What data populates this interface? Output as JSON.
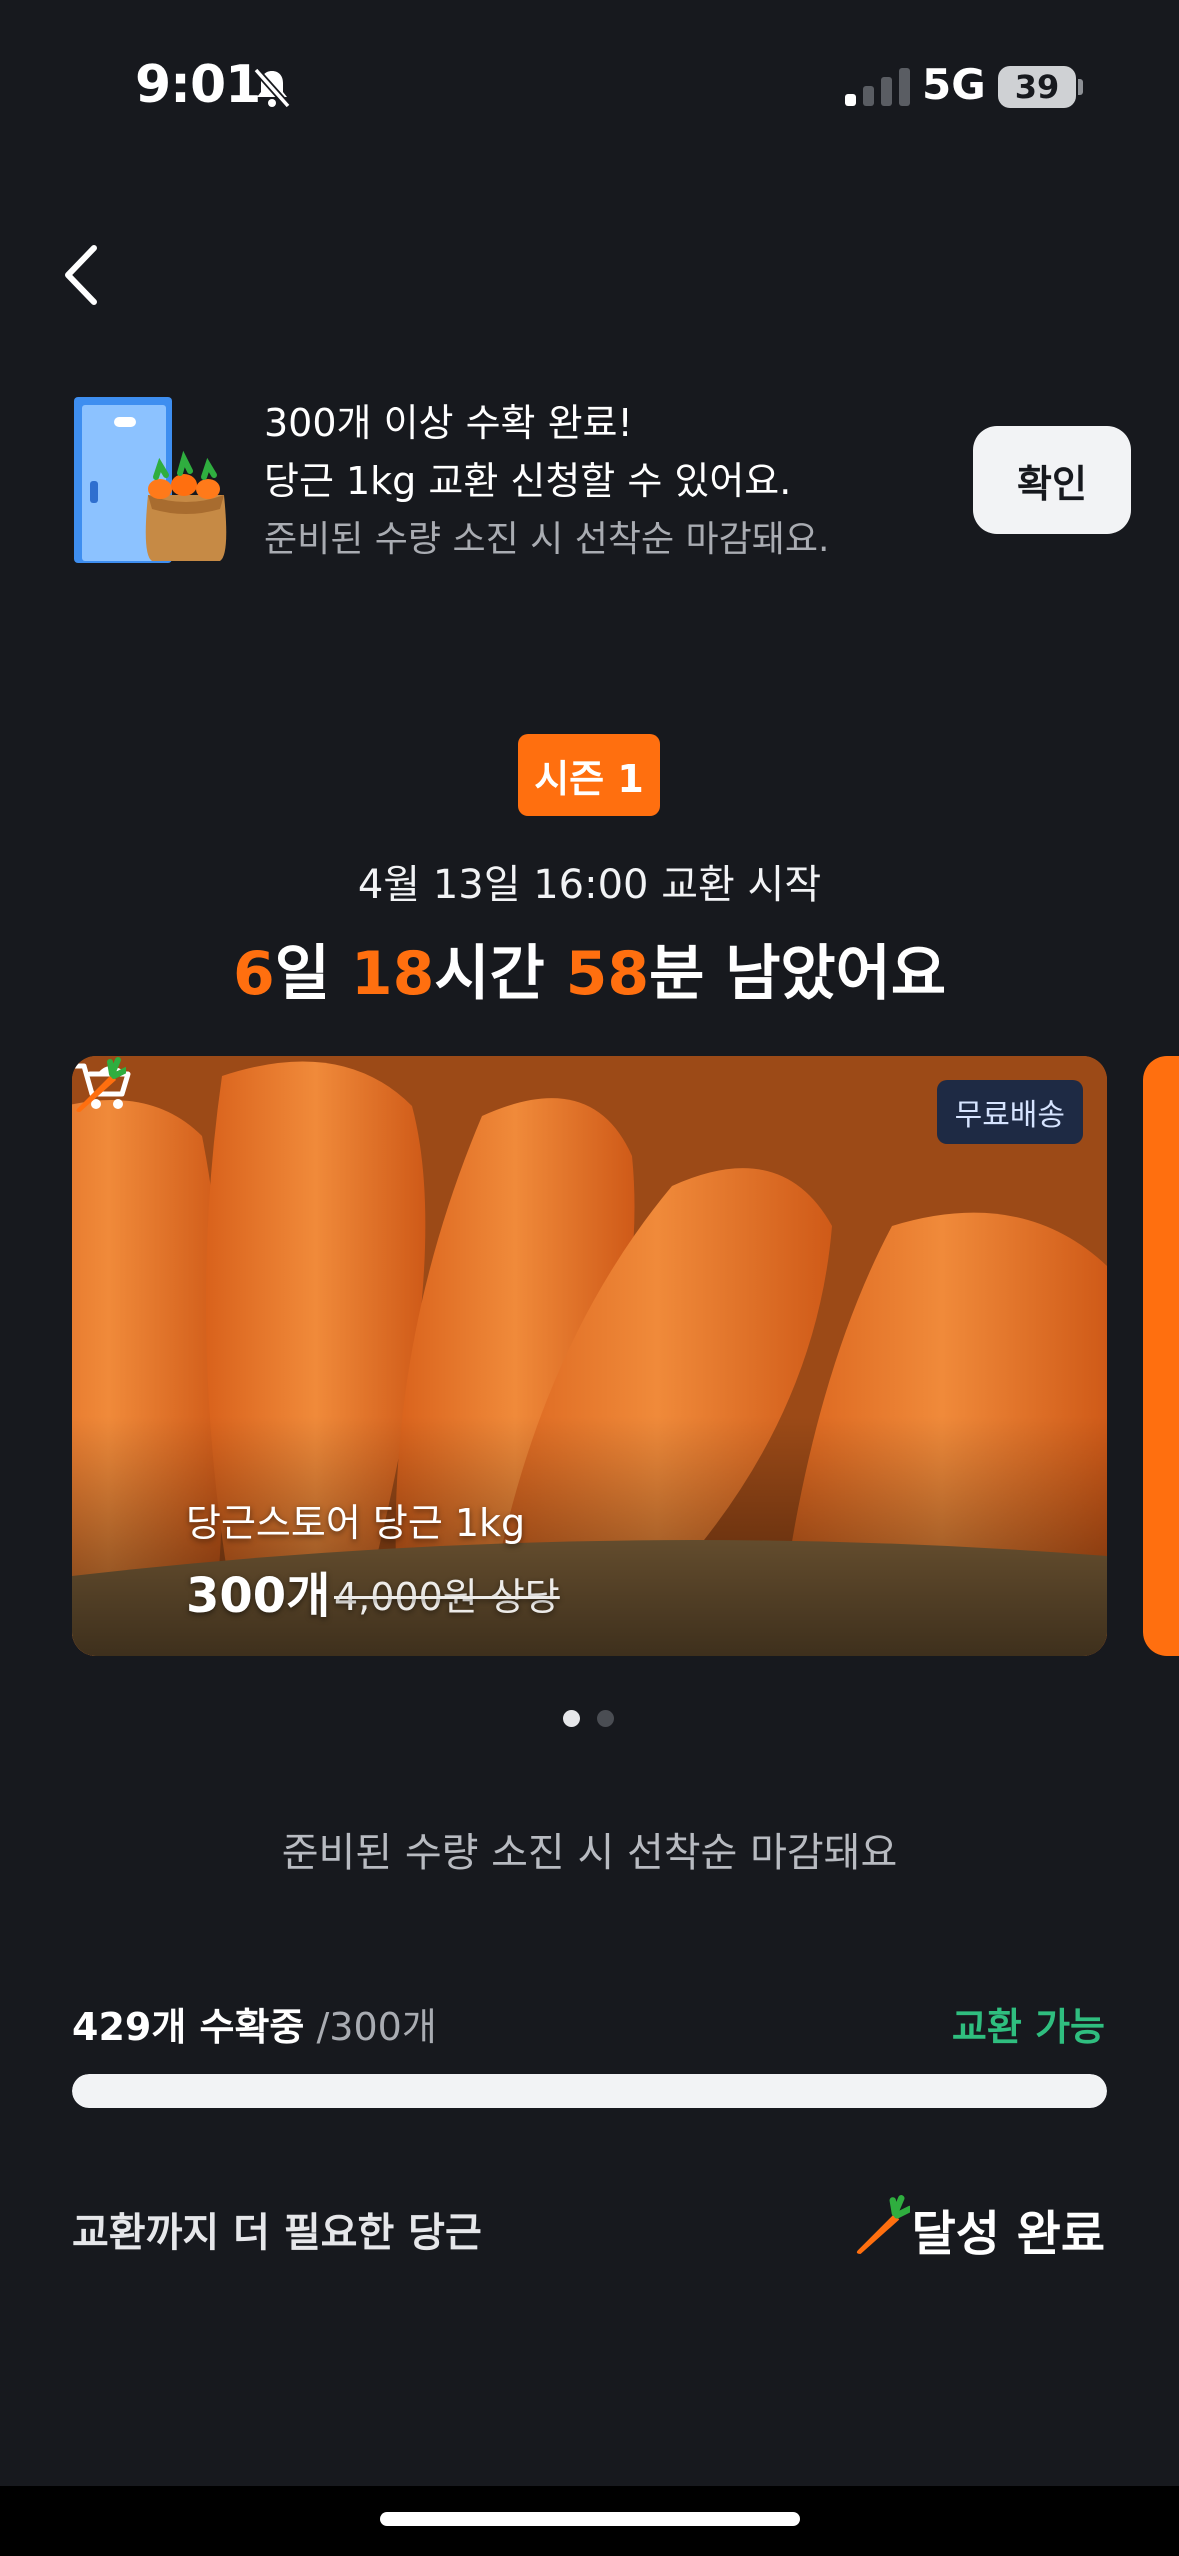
{
  "status_bar": {
    "time": "9:01",
    "network": "5G",
    "battery": "39",
    "bell_icon": "bell-slash-icon"
  },
  "nav": {
    "back_icon": "chevron-left-icon"
  },
  "banner": {
    "line1": "300개 이상 수확 완료!",
    "line2": "당근 1kg 교환 신청할 수 있어요.",
    "line3": "준비된 수량 소진 시 선착순 마감돼요.",
    "confirm_label": "확인",
    "illustration": "door-carrot-sack-icon"
  },
  "season": {
    "badge": "시즌 1",
    "start_text": "4월 13일 16:00 교환 시작",
    "countdown": {
      "days": "6",
      "days_unit": "일 ",
      "hours": "18",
      "hours_unit": "시간 ",
      "minutes": "58",
      "minutes_unit": "분 남았어요"
    }
  },
  "card": {
    "badge": "무료배송",
    "name": "당근스토어 당근 1kg",
    "price": "300개",
    "original_price": "4,000원 상당",
    "cart_icon": "shopping-cart-icon",
    "carrot_icon": "carrot-icon"
  },
  "carousel": {
    "count": 2,
    "active": 0
  },
  "note": "준비된 수량 소진 시 선착순 마감돼요",
  "progress": {
    "harvested": "429개 수확중",
    "goal": " /300개",
    "status": "교환 가능",
    "fraction": 1.0
  },
  "need": {
    "label": "교환까지 더 필요한 당근",
    "value": "달성 완료",
    "icon": "carrot-icon"
  },
  "colors": {
    "accent": "#ff6f0f",
    "success": "#2fbe7f",
    "background": "#17191e"
  }
}
